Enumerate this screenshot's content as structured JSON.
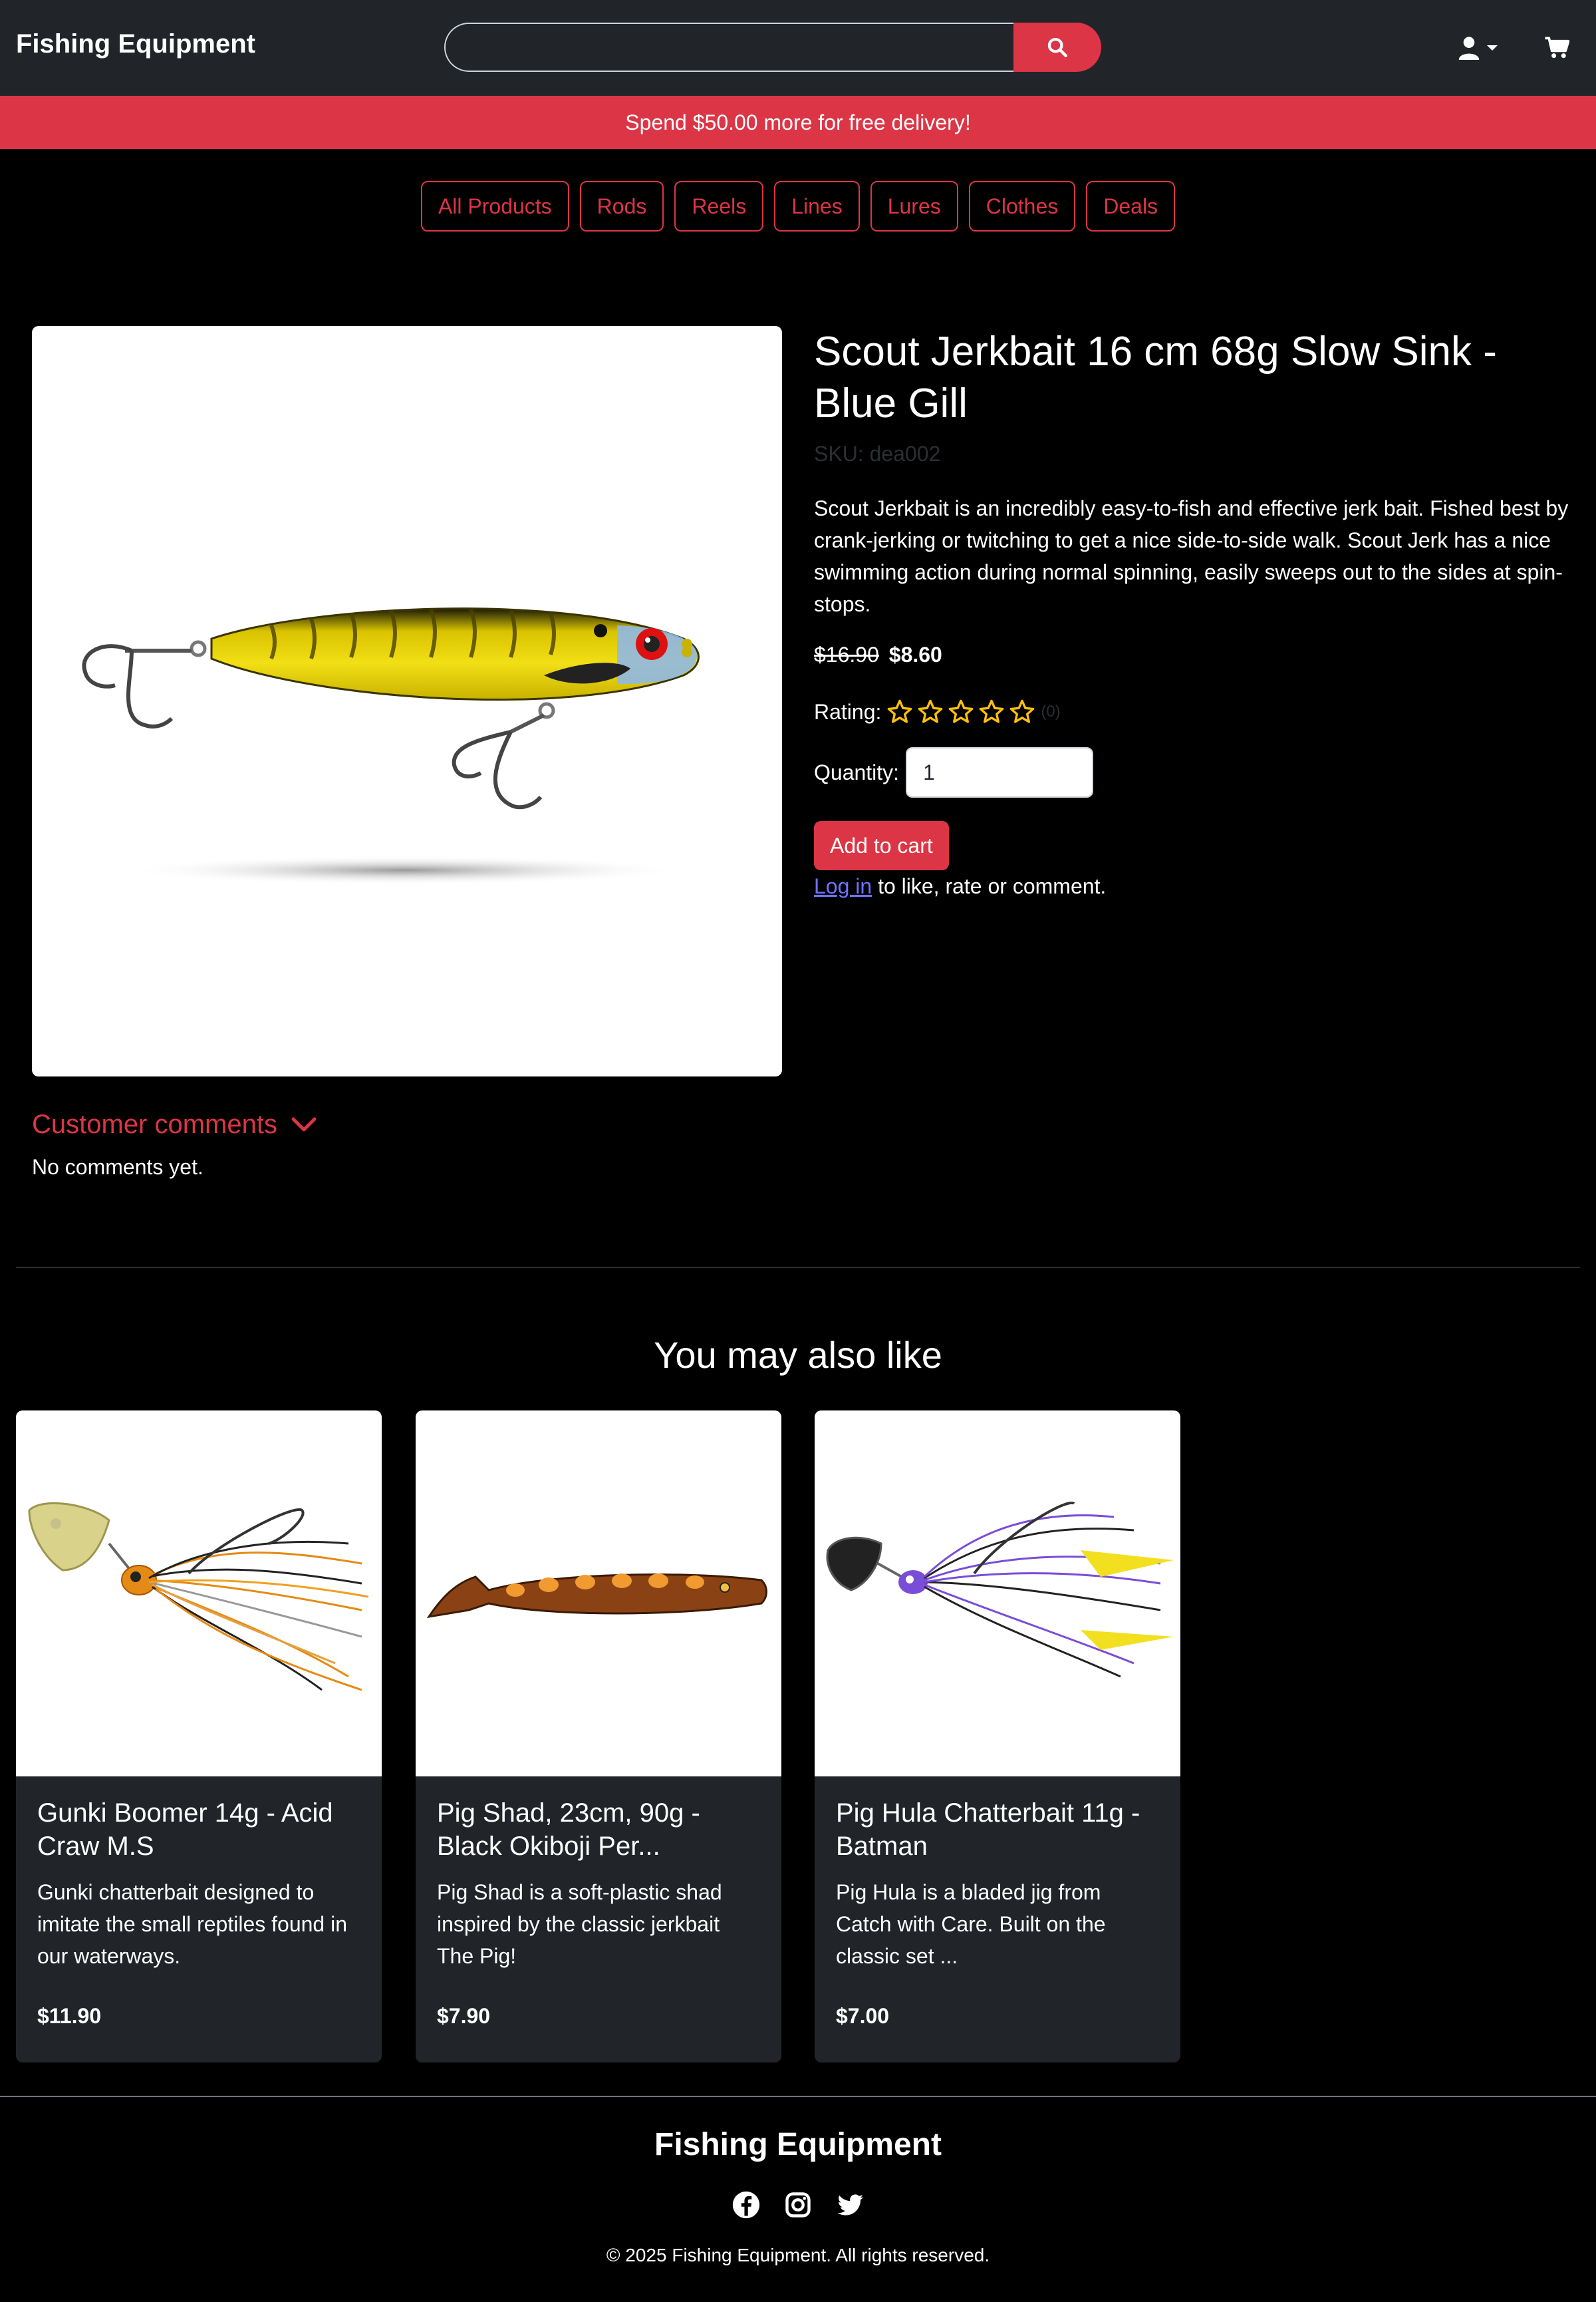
{
  "header": {
    "brand": "Fishing Equipment",
    "search_placeholder": "",
    "search_icon": "search-icon",
    "user_icon": "user-icon",
    "cart_icon": "cart-icon"
  },
  "banner": {
    "text": "Spend $50.00 more for free delivery!"
  },
  "categories": [
    "All Products",
    "Rods",
    "Reels",
    "Lines",
    "Lures",
    "Clothes",
    "Deals"
  ],
  "product": {
    "title": "Scout Jerkbait 16 cm 68g Slow Sink - Blue Gill",
    "sku_label": "SKU:",
    "sku": "dea002",
    "description": "Scout Jerkbait is an incredibly easy-to-fish and effective jerk bait. Fished best by crank-jerking or twitching to get a nice side-to-side walk. Scout Jerk has a nice swimming action during normal spinning, easily sweeps out to the sides at spin-stops.",
    "old_price": "$16.90",
    "price": "$8.60",
    "rating_label": "Rating:",
    "rating_value": 0,
    "rating_max": 5,
    "rating_count": "(0)",
    "quantity_label": "Quantity:",
    "quantity": "1",
    "add_to_cart": "Add to cart",
    "login_link": "Log in",
    "login_suffix": " to like, rate or comment."
  },
  "comments": {
    "toggle_label": "Customer comments",
    "empty_text": "No comments yet."
  },
  "recommendations": {
    "title": "You may also like",
    "items": [
      {
        "title": "Gunki Boomer 14g - Acid Craw M.S",
        "description": "Gunki chatterbait designed to imitate the small reptiles found in our waterways.",
        "price": "$11.90"
      },
      {
        "title": "Pig Shad, 23cm, 90g - Black Okiboji Per...",
        "description": "Pig Shad is a soft-plastic shad inspired by the classic jerkbait The Pig!",
        "price": "$7.90"
      },
      {
        "title": "Pig Hula Chatterbait 11g - Batman",
        "description": "Pig Hula is a bladed jig from Catch with Care. Built on the classic set ...",
        "price": "$7.00"
      }
    ]
  },
  "footer": {
    "brand": "Fishing Equipment",
    "socials": [
      "facebook-icon",
      "instagram-icon",
      "twitter-icon"
    ],
    "copyright": "© 2025 Fishing Equipment. All rights reserved."
  },
  "colors": {
    "accent": "#dc3545",
    "navbar": "#212529",
    "star": "#ffc107"
  }
}
